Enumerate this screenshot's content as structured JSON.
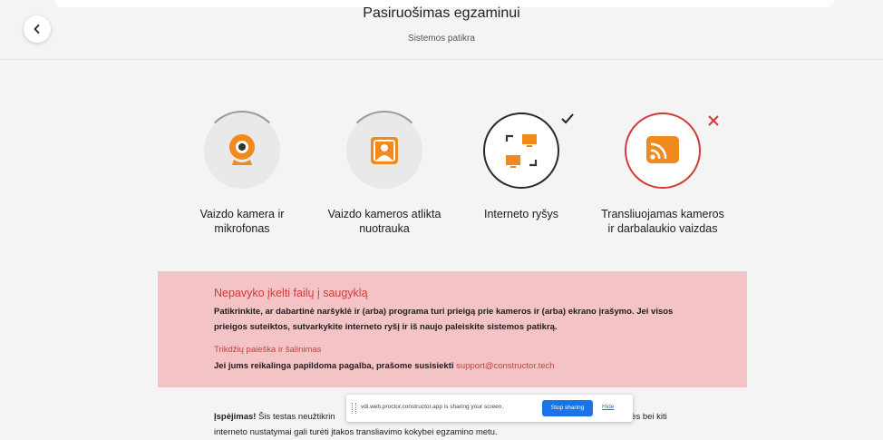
{
  "header": {
    "title": "Pasiruošimas egzaminui",
    "subtitle": "Sistemos patikra"
  },
  "steps": [
    {
      "label": "Vaizdo kamera ir mikrofonas",
      "icon": "webcam-icon",
      "status": "in-progress"
    },
    {
      "label": "Vaizdo kameros atlikta nuotrauka",
      "icon": "portrait-photo-icon",
      "status": "in-progress"
    },
    {
      "label": "Interneto ryšys",
      "icon": "network-computers-icon",
      "status": "success"
    },
    {
      "label": "Transliuojamas kameros ir darbalaukio vaizdas",
      "icon": "cast-icon",
      "status": "failed"
    }
  ],
  "alert": {
    "title": "Nepavyko įkelti failų į saugyklą",
    "body": "Patikrinkite, ar dabartinė naršyklė ir (arba) programa turi prieigą prie kameros ir (arba) ekrano įrašymo. Jei visos prieigos suteiktos, sutvarkykite interneto ryšį ir iš naujo paleiskite sistemos patikrą.",
    "troubleshoot_link": "Trikdžių paieška ir šalinimas",
    "help_text": "Jei jums reikalinga papildoma pagalba, prašome susisiekti",
    "email": "support@constructor.tech"
  },
  "warning": {
    "strong": "Įspėjimas!",
    "text_start": "Šis testas neužtikrin",
    "text_end": "nės bei kiti",
    "line2": "interneto nustatymai gali turėti įtakos transliavimo kokybei egzamino metu."
  },
  "share_bar": {
    "message": "vdi.web.proctor.constructor.app is sharing your screen.",
    "stop_label": "Stop sharing",
    "hide_label": "Hide"
  },
  "colors": {
    "accent_orange": "#f08a1c",
    "error_red": "#d33a3a",
    "alert_bg": "#f3c3c6",
    "share_blue": "#1a73e8"
  }
}
